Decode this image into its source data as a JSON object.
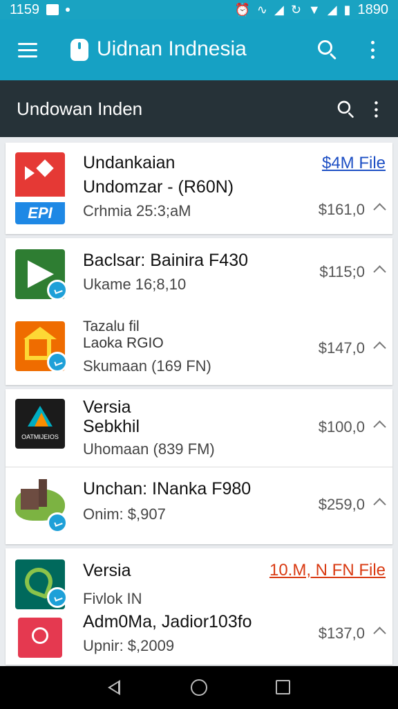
{
  "status_bar": {
    "time": "1159",
    "clock": "1890",
    "icons": [
      "image-icon",
      "dot-icon",
      "alarm-icon",
      "vibrate-icon",
      "signal-icon",
      "sync-icon",
      "wifi-icon",
      "battery-icon"
    ]
  },
  "app_bar": {
    "title": "Uidnan Indnesia",
    "icons": [
      "menu-icon",
      "app-logo-icon",
      "search-icon",
      "more-vert-icon"
    ]
  },
  "sub_header": {
    "title": "Undowan Inden",
    "icons": [
      "search-icon",
      "more-vert-icon"
    ]
  },
  "cards": [
    {
      "rows": [
        {
          "line1": "Undankaian",
          "line2": "Undomzar - (R60N)",
          "line3": "Crhmia 25:3;aM",
          "price": "$161,0",
          "link": "$4M File",
          "thumb_label": "EPI",
          "thumb_colors": [
            "#e53935",
            "#1e88e5"
          ]
        }
      ]
    },
    {
      "rows": [
        {
          "line1": "Baclsar: Bainira F430",
          "line2": "Ukame 16;8,10",
          "price": "$115;0",
          "thumb_colors": [
            "#2e7d32",
            "#ffffff"
          ]
        },
        {
          "line1": "Tazalu fil",
          "line2": "Laoka RGIO",
          "line3": "Skumaan (169 FN)",
          "price": "$147,0",
          "thumb_colors": [
            "#ef6c00",
            "#fdd835"
          ]
        }
      ]
    },
    {
      "rows": [
        {
          "line1": "Versia",
          "line2": "Sebkhil",
          "line3": "Uhomaan (839 FM)",
          "price": "$100,0",
          "thumb_label": "OATMIJEIOS",
          "thumb_colors": [
            "#1b1b1b",
            "#00acc1"
          ]
        },
        {
          "line1": "Unchan: INanka F980",
          "line2": "Onim: $,907",
          "price": "$259,0",
          "thumb_colors": [
            "#558b2f",
            "#6d4c41"
          ]
        }
      ]
    },
    {
      "rows": [
        {
          "line1": "Versia",
          "line2": "Fivlok IN",
          "link": "10.M, N FN File",
          "thumb_colors": [
            "#00695c",
            "#8bc34a"
          ]
        },
        {
          "line1": "Adm0Ma, Jadior103fo",
          "line2": "Upnir: $,2009",
          "price": "$137,0",
          "thumb_colors": [
            "#e53950",
            "#ffffff"
          ]
        }
      ]
    }
  ],
  "nav_bar": {
    "icons": [
      "back-icon",
      "home-icon",
      "recents-icon"
    ]
  }
}
